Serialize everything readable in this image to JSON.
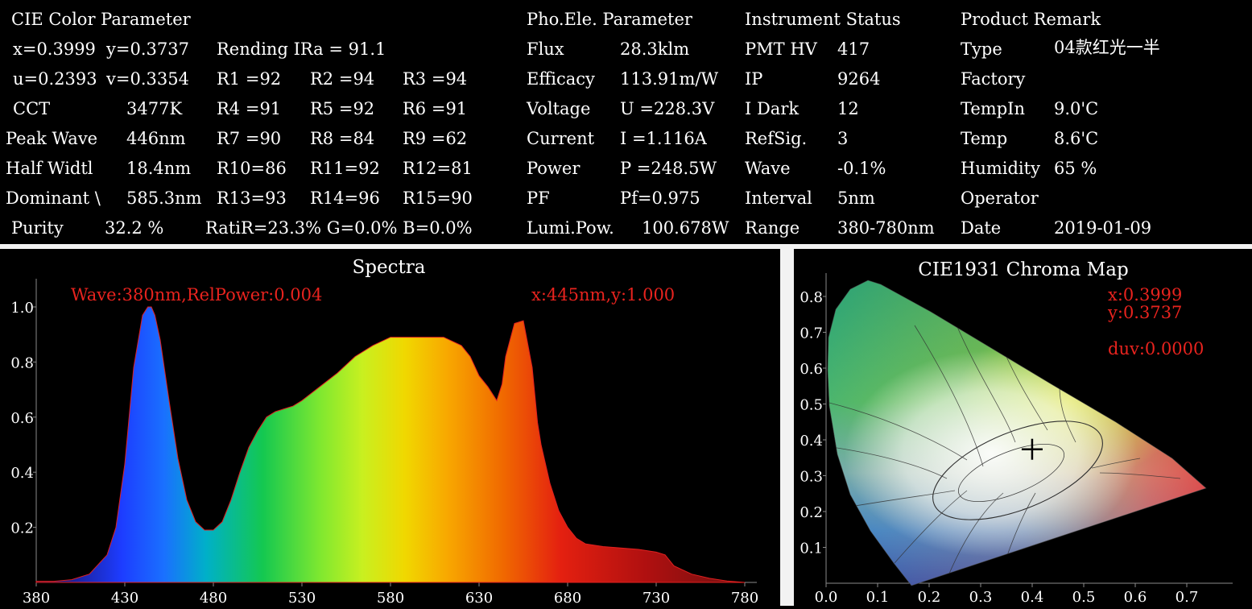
{
  "cie": {
    "header": "CIE Color Parameter",
    "x": "x=0.3999",
    "y": "y=0.3737",
    "u": "u=0.2393",
    "v": "v=0.3354",
    "cct_label": "CCT",
    "cct_value": "3477K",
    "peak_label": "Peak Wave",
    "peak_value": "446nm",
    "half_label": "Half Widtl",
    "half_value": "18.4nm",
    "dom_label": "Dominant \\",
    "dom_value": "585.3nm",
    "purity_label": "Purity",
    "purity_value": "32.2 %",
    "rendering": "Rending IRa = 91.1",
    "ratio": "RatiR=23.3% G=0.0% B=0.0%",
    "r_values": [
      "R1 =92",
      "R2 =94",
      "R3 =94",
      "R4 =91",
      "R5 =92",
      "R6 =91",
      "R7 =90",
      "R8 =84",
      "R9 =62",
      "R10=86",
      "R11=92",
      "R12=81",
      "R13=93",
      "R14=96",
      "R15=90"
    ]
  },
  "pho": {
    "header": "Pho.Ele. Parameter",
    "rows": [
      {
        "label": "Flux",
        "value": "28.3klm"
      },
      {
        "label": "Efficacy",
        "value": "113.91m/W"
      },
      {
        "label": "Voltage",
        "value": "U =228.3V"
      },
      {
        "label": "Current",
        "value": "I =1.116A"
      },
      {
        "label": "Power",
        "value": "P =248.5W"
      },
      {
        "label": "PF",
        "value": "Pf=0.975"
      },
      {
        "label": "Lumi.Pow.",
        "value": "100.678W"
      }
    ]
  },
  "inst": {
    "header": "Instrument Status",
    "rows": [
      {
        "label": "PMT HV",
        "value": "417"
      },
      {
        "label": "IP",
        "value": "9264"
      },
      {
        "label": "I Dark",
        "value": "12"
      },
      {
        "label": "RefSig.",
        "value": "3"
      },
      {
        "label": "Wave",
        "value": "-0.1%"
      },
      {
        "label": "Interval",
        "value": "5nm"
      },
      {
        "label": "Range",
        "value": "380-780nm"
      }
    ]
  },
  "prod": {
    "header": "Product Remark",
    "rows": [
      {
        "label": "Type",
        "value": "04款红光一半"
      },
      {
        "label": "Factory",
        "value": ""
      },
      {
        "label": "TempIn",
        "value": "9.0'C"
      },
      {
        "label": "Temp",
        "value": "8.6'C"
      },
      {
        "label": "Humidity",
        "value": "65 %"
      },
      {
        "label": "Operator",
        "value": ""
      },
      {
        "label": "Date",
        "value": "2019-01-09"
      }
    ]
  },
  "spectra": {
    "title": "Spectra",
    "cursor_readout": "Wave:380nm,RelPower:0.004",
    "peak_readout": "x:445nm,y:1.000"
  },
  "chroma": {
    "title": "CIE1931 Chroma Map",
    "x_readout": "x:0.3999",
    "y_readout": "y:0.3737",
    "duv_readout": "duv:0.0000"
  },
  "colors": {
    "background": "#000000",
    "text": "#ffffff",
    "readout": "#e8231e",
    "separator": "#f2f2f2"
  },
  "chart_data": [
    {
      "type": "area",
      "title": "Spectra",
      "xlabel": "",
      "ylabel": "",
      "xlim": [
        380,
        780
      ],
      "ylim": [
        0,
        1.1
      ],
      "xticks": [
        "380",
        "430",
        "480",
        "530",
        "580",
        "630",
        "680",
        "730",
        "780"
      ],
      "yticks": [
        "0.2",
        "0.4",
        "0.6",
        "0.8",
        "1.0"
      ],
      "x": [
        380,
        390,
        400,
        410,
        420,
        425,
        430,
        435,
        440,
        443,
        445,
        447,
        450,
        455,
        460,
        465,
        470,
        475,
        480,
        485,
        490,
        495,
        500,
        505,
        510,
        515,
        520,
        525,
        530,
        540,
        550,
        560,
        570,
        580,
        590,
        600,
        605,
        610,
        620,
        625,
        630,
        635,
        640,
        643,
        645,
        650,
        655,
        660,
        663,
        665,
        670,
        675,
        680,
        685,
        690,
        700,
        710,
        720,
        730,
        735,
        740,
        750,
        760,
        770,
        780
      ],
      "y": [
        0.004,
        0.004,
        0.01,
        0.03,
        0.1,
        0.2,
        0.43,
        0.78,
        0.97,
        1.0,
        1.0,
        0.97,
        0.88,
        0.66,
        0.45,
        0.3,
        0.22,
        0.19,
        0.19,
        0.22,
        0.3,
        0.4,
        0.49,
        0.55,
        0.6,
        0.62,
        0.63,
        0.64,
        0.66,
        0.71,
        0.76,
        0.82,
        0.86,
        0.89,
        0.89,
        0.89,
        0.89,
        0.89,
        0.86,
        0.82,
        0.75,
        0.71,
        0.66,
        0.72,
        0.82,
        0.94,
        0.95,
        0.78,
        0.58,
        0.5,
        0.36,
        0.26,
        0.2,
        0.16,
        0.14,
        0.13,
        0.125,
        0.12,
        0.11,
        0.1,
        0.06,
        0.03,
        0.015,
        0.005,
        0.0
      ]
    },
    {
      "type": "scatter",
      "title": "CIE1931 Chroma Map",
      "xlim": [
        0,
        0.8
      ],
      "ylim": [
        0,
        0.9
      ],
      "xticks": [
        "0.0",
        "0.1",
        "0.2",
        "0.3",
        "0.4",
        "0.5",
        "0.6",
        "0.7"
      ],
      "yticks": [
        "0.1",
        "0.2",
        "0.3",
        "0.4",
        "0.5",
        "0.6",
        "0.7",
        "0.8"
      ],
      "point": {
        "x": 0.3999,
        "y": 0.3737
      }
    }
  ]
}
